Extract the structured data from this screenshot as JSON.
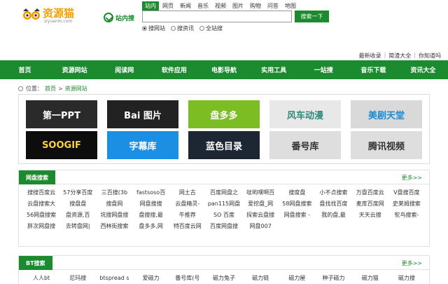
{
  "header": {
    "logo_text": "资源猫",
    "logo_sub": "ziyuanm.com",
    "site_search_label": "站内搜",
    "search_tabs": [
      "站内",
      "网页",
      "新闻",
      "音乐",
      "视频",
      "图片",
      "购物",
      "问答",
      "地图"
    ],
    "search_value": "",
    "search_button": "搜索一下",
    "radios": [
      {
        "label": "搜网站",
        "checked": true
      },
      {
        "label": "搜资讯",
        "checked": false
      },
      {
        "label": "全站搜",
        "checked": false
      }
    ],
    "top_links": [
      "最新收录",
      "简渣大全",
      "你知道吗"
    ]
  },
  "nav": [
    "首页",
    "资源网站",
    "阅读网",
    "软件应用",
    "电影导航",
    "实用工具",
    "一站搜",
    "音乐下载",
    "资讯大全"
  ],
  "breadcrumb": {
    "prefix": "位置：",
    "home": "首页",
    "separator": ">",
    "current": "资源网站"
  },
  "featured_sites": [
    {
      "label": "第一PPT",
      "icon": "ppt-logo"
    },
    {
      "label": "Bai 图片",
      "icon": "baidu-paw-logo"
    },
    {
      "label": "盘多多",
      "icon": "pan-logo"
    },
    {
      "label": "风车动漫",
      "icon": "windmill-logo"
    },
    {
      "label": "美剧天堂",
      "icon": "meiju-tv-logo"
    },
    {
      "label": "SOOGIF",
      "icon": "soogif-logo"
    },
    {
      "label": "字幕库",
      "icon": "subtitle-logo"
    },
    {
      "label": "蓝色目录",
      "icon": "lanse-logo"
    },
    {
      "label": "番号库",
      "icon": "fanhao-logo"
    },
    {
      "label": "腾讯视频",
      "icon": "tencent-video-logo"
    }
  ],
  "pan_section": {
    "title": "网盘搜索",
    "more": "更多>>",
    "links": [
      "搜搜百度云",
      "57分享百度",
      "三百搜(3b",
      "fastsoso百",
      "网土古",
      "百度网盘之",
      "呔哟嘿啊百",
      "搜度盘",
      "小不点搜索",
      "万盘百度云",
      "V盘搜百度",
      "云盘搜索大",
      "搜盘盘",
      "搜盘网",
      "网盘搜搜",
      "云盘精灵-",
      "pan115网盘",
      "爱挖盘_网",
      "58网盘搜索",
      "盘找找百度",
      "麦库百度网",
      "史莱姆搜索",
      "56网盘搜索",
      "盘资源,百",
      "坑搜网盘搜",
      "盘搜搜,最",
      "牛推荐",
      "SO 百度",
      "探索云盘搜",
      "网盘搜索 -",
      "我的盘,最",
      "天天云搜",
      "鸵鸟搜索-",
      "胖次网盘搜",
      "去转盘网|",
      "西林街搜索",
      "盘多多,网",
      "特百度云网",
      "百度网盘搜",
      "网盘007"
    ]
  },
  "bt_section": {
    "title": "BT搜索",
    "more": "更多>>",
    "links": [
      "人人bt",
      "尼玛搜",
      "btspread s",
      "爱磁力",
      "番号库(号",
      "磁力兔子",
      "磁力链",
      "磁力屋",
      "种子磁力",
      "磁力猫",
      "磁力搜"
    ]
  },
  "colors": {
    "brand_green": "#1c8a2e",
    "logo_orange": "#f2a100"
  }
}
